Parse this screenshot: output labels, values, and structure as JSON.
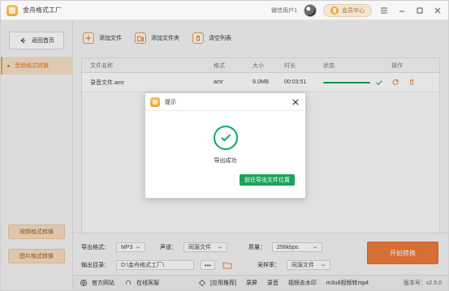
{
  "window": {
    "app_title": "金舟格式工厂",
    "user_label": "微信用户1",
    "vip_label": "会员中心"
  },
  "sidebar": {
    "back_label": "返回首页",
    "active_item": "音频格式转换",
    "bottom_buttons": [
      "视频格式转换",
      "图片格式转换"
    ]
  },
  "toolbar": {
    "add_file": "添加文件",
    "add_folder": "添加文件夹",
    "clear_list": "清空列表"
  },
  "table": {
    "headers": [
      "文件名称",
      "格式",
      "大小",
      "时长",
      "状态",
      "操作"
    ],
    "rows": [
      {
        "name": "录音文件.amr",
        "format": "amr",
        "size": "9.0MB",
        "duration": "00:03:51",
        "progress": 100
      }
    ]
  },
  "settings": {
    "output_format_label": "导出格式：",
    "output_format_value": "MP3",
    "channel_label": "声道：",
    "channel_value": "同源文件",
    "quality_label": "质量：",
    "quality_value": "256kbps",
    "output_dir_label": "输出目录：",
    "output_dir_value": "D:\\金舟格式工厂\\",
    "sample_rate_label": "采样率：",
    "sample_rate_value": "同源文件",
    "start_label": "开始转换",
    "dots": "•••"
  },
  "footer": {
    "items": [
      "官方网站",
      "在线客服",
      "[应用推荐]",
      "录屏",
      "录音",
      "视频去水印",
      "m3u8视频转mp4"
    ],
    "version": "版本号：v2.5.0"
  },
  "dialog": {
    "title": "提示",
    "message": "导出成功",
    "button": "前往导出文件位置"
  },
  "colors": {
    "accent": "#f2a53a",
    "start_button": "#f07c3b",
    "success_green": "#12a65a"
  },
  "icons": {
    "back": "back-arrow-icon",
    "add_file": "plus-icon",
    "add_folder": "folder-plus-icon",
    "clear_list": "trash-icon",
    "refresh": "refresh-icon",
    "delete": "delete-icon",
    "success": "check-circle-icon"
  }
}
